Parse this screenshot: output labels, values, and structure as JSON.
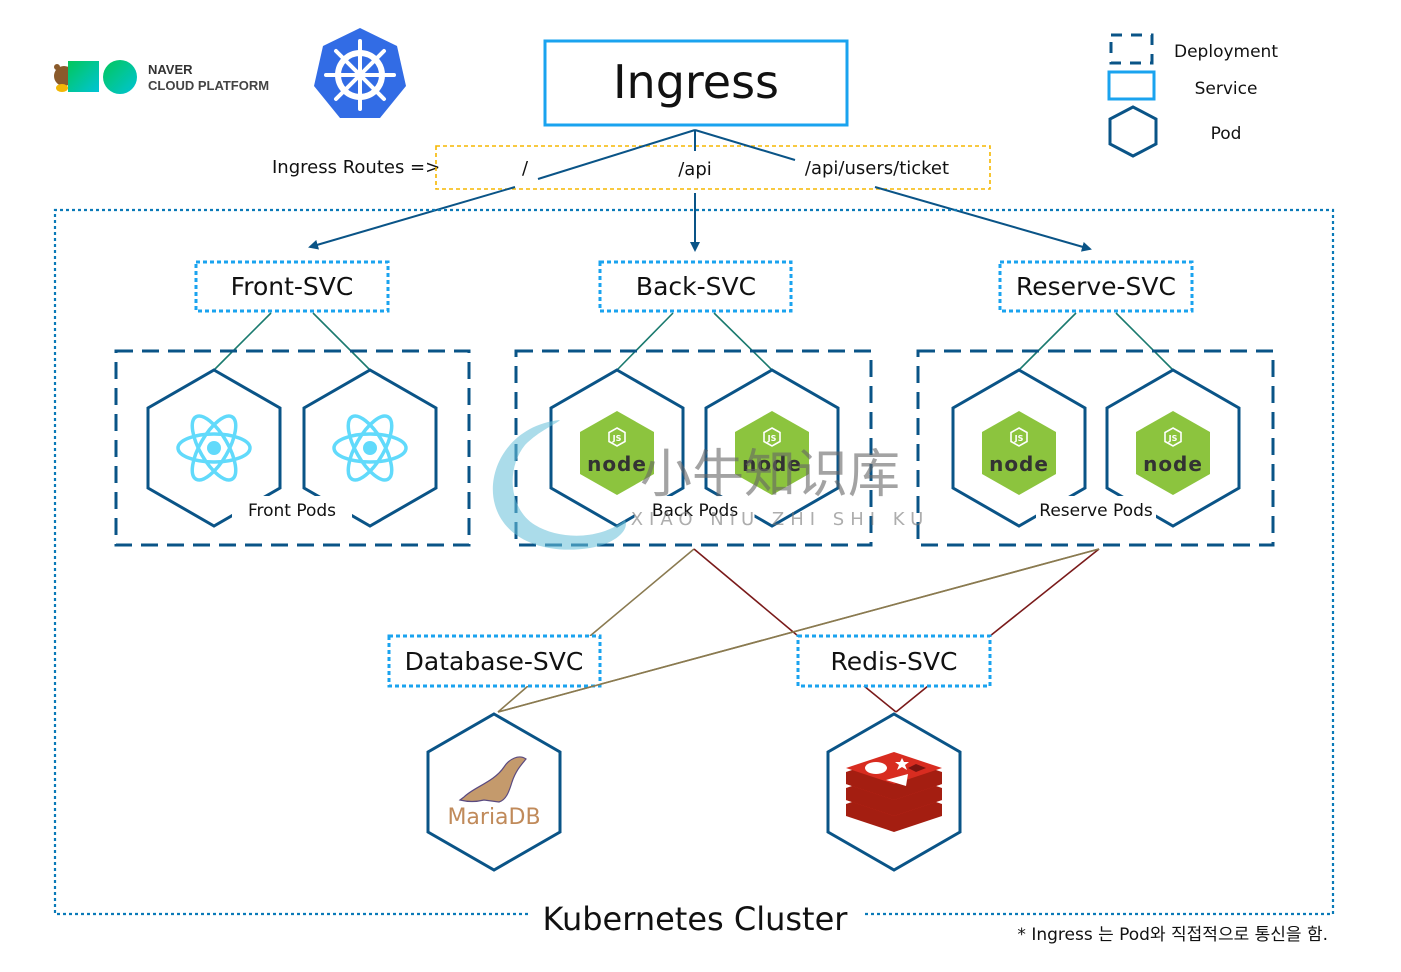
{
  "header": {
    "naver_logo_line1": "NAVER",
    "naver_logo_line2": "CLOUD PLATFORM",
    "kubernetes_logo": "kubernetes-helm-icon"
  },
  "ingress": {
    "title": "Ingress",
    "routes_label": "Ingress Routes =>",
    "routes": [
      "/",
      "/api",
      "/api/users/ticket"
    ]
  },
  "legend": {
    "items": [
      {
        "icon": "dashed-square-icon",
        "label": "Deployment"
      },
      {
        "icon": "solid-rectangle-icon",
        "label": "Service"
      },
      {
        "icon": "hexagon-icon",
        "label": "Pod"
      }
    ]
  },
  "services": {
    "front": "Front-SVC",
    "back": "Back-SVC",
    "reserve": "Reserve-SVC",
    "database": "Database-SVC",
    "redis": "Redis-SVC"
  },
  "deployments": {
    "front": {
      "label": "Front Pods",
      "icon": "react-icon"
    },
    "back": {
      "label": "Back Pods",
      "icon": "nodejs-icon"
    },
    "reserve": {
      "label": "Reserve Pods",
      "icon": "nodejs-icon"
    }
  },
  "data_pods": {
    "mariadb": {
      "label": "MariaDB",
      "icon": "mariadb-seal-icon"
    },
    "redis": {
      "icon": "redis-icon"
    }
  },
  "nodejs": {
    "js": "JS",
    "word": "node"
  },
  "cluster": {
    "label": "Kubernetes Cluster"
  },
  "footnote": "* Ingress 는 Pod와 직접적으로 통신을 함.",
  "watermark": {
    "cn": "小牛知识库",
    "latin": "XIAO NIU ZHI SHI KU"
  },
  "colors": {
    "deployment_border": "#0a5487",
    "service_border": "#1aa3ef",
    "ingress_border": "#1aa3ef",
    "route_box_border": "#f5b700",
    "svc_to_pod_line": "#1a7a6e",
    "db_line": "#8a7a50",
    "redis_line": "#7a1a1a",
    "react": "#61dafb",
    "node_green": "#8cc43e",
    "k8s_blue": "#326ce5",
    "redis_red": "#d82c20"
  }
}
